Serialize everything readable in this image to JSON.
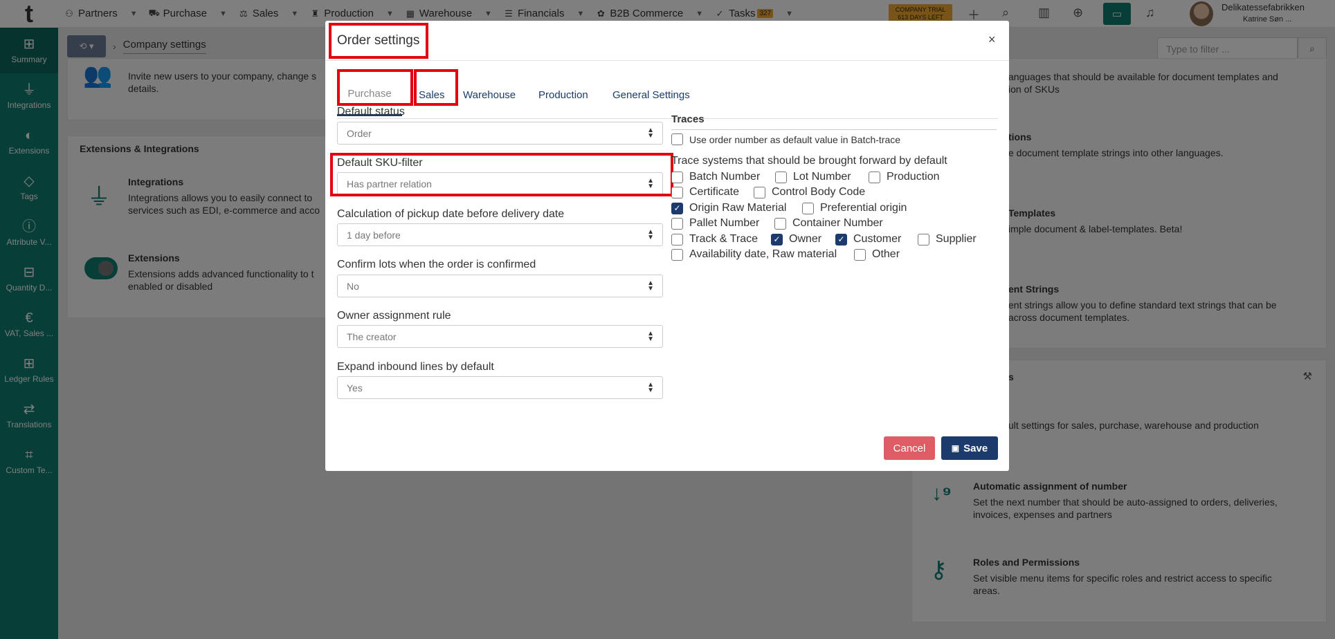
{
  "topbar": {
    "logo": "t",
    "nav": [
      {
        "icon": "handshake-icon",
        "glyph": "⚇",
        "label": "Partners"
      },
      {
        "icon": "cart-icon",
        "glyph": "⛟",
        "label": "Purchase"
      },
      {
        "icon": "sales-icon",
        "glyph": "⚖",
        "label": "Sales"
      },
      {
        "icon": "production-icon",
        "glyph": "♜",
        "label": "Production"
      },
      {
        "icon": "warehouse-icon",
        "glyph": "▦",
        "label": "Warehouse"
      },
      {
        "icon": "money-icon",
        "glyph": "☰",
        "label": "Financials"
      },
      {
        "icon": "b2b-icon",
        "glyph": "✿",
        "label": "B2B Commerce"
      },
      {
        "icon": "check-icon",
        "glyph": "✓",
        "label": "Tasks",
        "badge": "327"
      }
    ],
    "trial_line1": "COMPANY TRIAL",
    "trial_line2": "613 DAYS LEFT",
    "user_company": "Delikatessefabrikken",
    "user_name": "Katrine Søn ..."
  },
  "sidebar": [
    {
      "icon": "grid-icon",
      "glyph": "⊞",
      "label": "Summary"
    },
    {
      "icon": "plug-icon",
      "glyph": "⏚",
      "label": "Integrations"
    },
    {
      "icon": "toggle-icon",
      "glyph": "◐",
      "label": "Extensions"
    },
    {
      "icon": "tag-icon",
      "glyph": "◇",
      "label": "Tags"
    },
    {
      "icon": "info-icon",
      "glyph": "ⓘ",
      "label": "Attribute V..."
    },
    {
      "icon": "abacus-icon",
      "glyph": "⊟",
      "label": "Quantity D..."
    },
    {
      "icon": "euro-icon",
      "glyph": "€",
      "label": "VAT, Sales ..."
    },
    {
      "icon": "ledger-icon",
      "glyph": "⊞",
      "label": "Ledger Rules"
    },
    {
      "icon": "translate-icon",
      "glyph": "⇄",
      "label": "Translations"
    },
    {
      "icon": "code-file-icon",
      "glyph": "⌗",
      "label": "Custom Te..."
    }
  ],
  "breadcrumb": {
    "current": "Company settings"
  },
  "filter": {
    "placeholder": "Type to filter ..."
  },
  "background": {
    "invite_text_1": "Invite new users to your company, change s",
    "invite_text_2": "details.",
    "ext_section": "Extensions & Integrations",
    "integrations_title": "Integrations",
    "integrations_text_1": "Integrations allows you to easily connect to",
    "integrations_text_2": "services such as EDI, e-commerce and acco",
    "extensions_title": "Extensions",
    "extensions_text_1": "Extensions adds advanced functionality to t",
    "extensions_text_2": "enabled or disabled",
    "lang_text_1": "anguages that should be available for document templates and",
    "lang_text_2": "ion of SKUs",
    "tions_title": "tions",
    "tions_text": "e document template strings into other languages.",
    "templates_title": "Templates",
    "templates_text": "imple document & label-templates. Beta!",
    "strings_title": "ent Strings",
    "strings_text_1": "ent strings allow you to define standard text strings that can be",
    "strings_text_2": "across document templates.",
    "s_title": "s",
    "default_text": "ult settings for sales, purchase, warehouse and production",
    "autonum_title": "Automatic assignment of number",
    "autonum_text_1": "Set the next number that should be auto-assigned to orders, deliveries,",
    "autonum_text_2": "invoices, expenses and partners",
    "roles_title": "Roles and Permissions",
    "roles_text_1": "Set visible menu items for specific roles and restrict access to specific",
    "roles_text_2": "areas."
  },
  "modal": {
    "title": "Order settings",
    "close": "×",
    "tabs": [
      "Purchase",
      "Sales",
      "Warehouse",
      "Production",
      "General Settings"
    ],
    "fields": [
      {
        "label": "Default status",
        "value": "Order"
      },
      {
        "label": "Default SKU-filter",
        "value": "Has partner relation"
      },
      {
        "label": "Calculation of pickup date before delivery date",
        "value": "1 day before"
      },
      {
        "label": "Confirm lots when the order is confirmed",
        "value": "No"
      },
      {
        "label": "Owner assignment rule",
        "value": "The creator"
      },
      {
        "label": "Expand inbound lines by default",
        "value": "Yes"
      }
    ],
    "traces_title": "Traces",
    "use_order_number": "Use order number as default value in Batch-trace",
    "trace_heading": "Trace systems that should be brought forward by default",
    "trace_options": [
      {
        "label": "Batch Number",
        "checked": false
      },
      {
        "label": "Lot Number",
        "checked": false
      },
      {
        "label": "Production",
        "checked": false
      },
      {
        "label": "Certificate",
        "checked": false
      },
      {
        "label": "Control Body Code",
        "checked": false
      },
      {
        "label": "Origin Raw Material",
        "checked": true
      },
      {
        "label": "Preferential origin",
        "checked": false
      },
      {
        "label": "Pallet Number",
        "checked": false
      },
      {
        "label": "Container Number",
        "checked": false
      },
      {
        "label": "Track & Trace",
        "checked": false
      },
      {
        "label": "Owner",
        "checked": true
      },
      {
        "label": "Customer",
        "checked": true
      },
      {
        "label": "Supplier",
        "checked": false
      },
      {
        "label": "Availability date, Raw material",
        "checked": false
      },
      {
        "label": "Other",
        "checked": false
      }
    ],
    "cancel": "Cancel",
    "save": "Save"
  },
  "colors": {
    "teal": "#0e7d71",
    "navy": "#1c3a6b",
    "cancel": "#de5c64",
    "highlight": "#e3000f",
    "trial": "#f0a830"
  }
}
